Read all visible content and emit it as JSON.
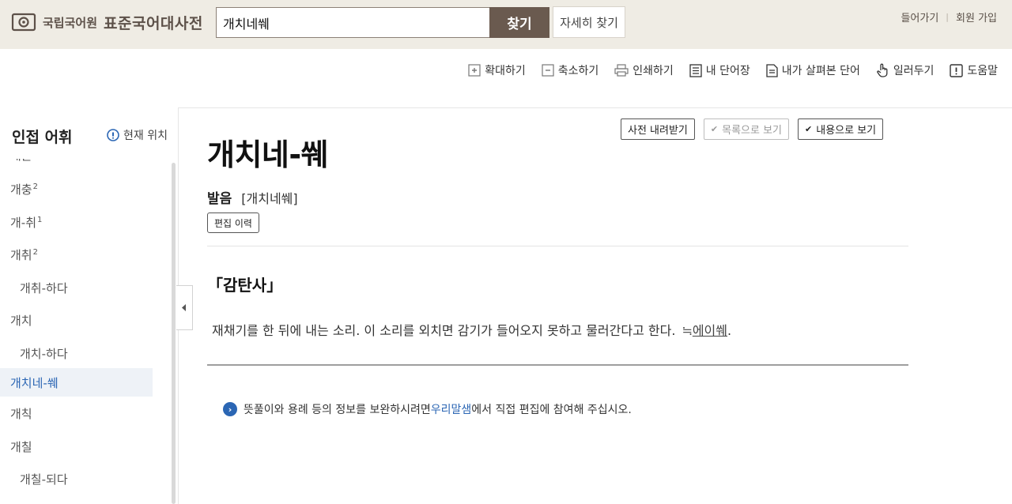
{
  "header": {
    "logo_small": "국립국어원",
    "logo_big": "표준국어대사전",
    "search_value": "개치네쒜",
    "search_button": "찾기",
    "detail_button": "자세히 찾기",
    "login": "들어가기",
    "signup": "회원 가입",
    "separator": "|"
  },
  "toolbar": {
    "zoom_in": "확대하기",
    "zoom_out": "축소하기",
    "print": "인쇄하기",
    "my_words": "내 단어장",
    "viewed_words": "내가 살펴본 단어",
    "notify": "일러두기",
    "help": "도움말"
  },
  "sidebar": {
    "title": "인접 어휘",
    "current_position": "현재 위치",
    "items": [
      {
        "label": "개춘",
        "sup": ""
      },
      {
        "label": "개충",
        "sup": "2"
      },
      {
        "label": "개-취",
        "sup": "1"
      },
      {
        "label": "개취",
        "sup": "2"
      },
      {
        "label": "개취-하다",
        "sup": ""
      },
      {
        "label": "개치",
        "sup": ""
      },
      {
        "label": "개치-하다",
        "sup": ""
      },
      {
        "label": "개치네-쒜",
        "sup": ""
      },
      {
        "label": "개칙",
        "sup": ""
      },
      {
        "label": "개칠",
        "sup": ""
      },
      {
        "label": "개칠-되다",
        "sup": ""
      }
    ]
  },
  "main": {
    "download_btn": "사전 내려받기",
    "list_view_btn": "목록으로 보기",
    "content_view_btn": "내용으로 보기",
    "headword": "개치네-쒜",
    "pron_label": "발음",
    "pron_value": "[개치네쒜]",
    "edit_history": "편집 이력",
    "pos": "「감탄사」",
    "definition": "재채기를 한 뒤에 내는 소리. 이 소리를 외치면 감기가 들어오지 못하고 물러간다고 한다.",
    "approx_symbol": "≒",
    "related_word": "에이쒜",
    "period": ".",
    "notice_pre": "뜻풀이와 용례 등의 정보를 보완하시려면 ",
    "notice_link": "우리말샘",
    "notice_post": "에서 직접 편집에 참여해 주십시오."
  },
  "colors": {
    "header_bg": "#efece4",
    "brand_brown": "#6a5a4f",
    "link_blue": "#2b66b4"
  }
}
